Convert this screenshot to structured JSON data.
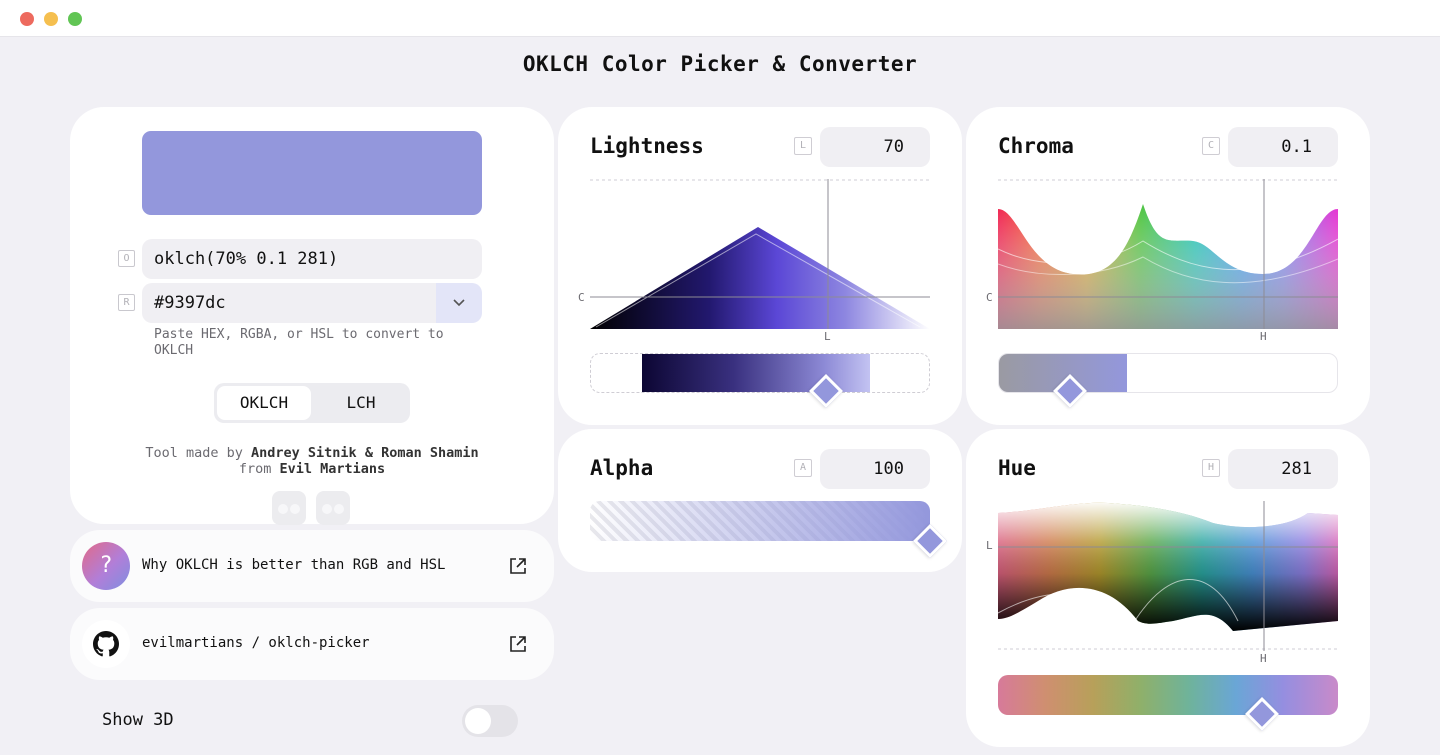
{
  "window": {
    "title": "OKLCH Color Picker & Converter"
  },
  "colors": {
    "current": "#9397dc",
    "accent_bg": "#e3e5f8"
  },
  "main": {
    "oklch_tag": "O",
    "oklch_value": "oklch(70% 0.1 281)",
    "rgb_tag": "R",
    "hex_value": "#9397dc",
    "hint": "Paste HEX, RGBA, or HSL to convert to OKLCH",
    "mode_options": [
      "OKLCH",
      "LCH"
    ],
    "mode_selected": "OKLCH",
    "credit_prefix": "Tool made by",
    "credit_author1": "Andrey Sitnik",
    "credit_amp": "&",
    "credit_author2": "Roman Shamin",
    "credit_from": "from",
    "credit_org": "Evil Martians"
  },
  "links": {
    "why_badge": "?",
    "why": "Why OKLCH is better than RGB and HSL",
    "github": "evilmartians / oklch-picker"
  },
  "show3d": {
    "label": "Show 3D",
    "enabled": false
  },
  "lightness": {
    "title": "Lightness",
    "tag": "L",
    "value": "70",
    "axis_y": "C",
    "axis_x": "L",
    "level": 0.7
  },
  "chroma": {
    "title": "Chroma",
    "tag": "C",
    "value": "0.1",
    "axis_y": "C",
    "axis_x": "H",
    "level": 0.1
  },
  "alpha": {
    "title": "Alpha",
    "tag": "A",
    "value": "100",
    "level": 1.0
  },
  "hue": {
    "title": "Hue",
    "tag": "H",
    "value": "281",
    "axis_y": "L",
    "axis_x": "H",
    "level": 281
  }
}
